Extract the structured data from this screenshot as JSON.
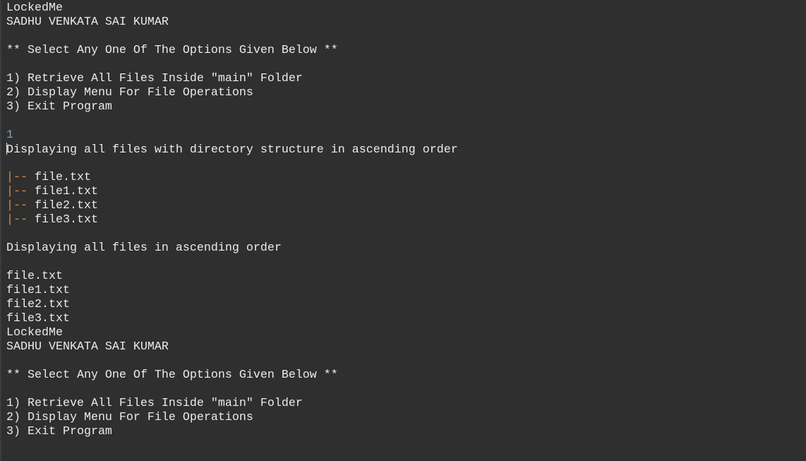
{
  "console": {
    "menu1": {
      "app": "LockedMe",
      "author": "SADHU VENKATA SAI KUMAR",
      "prompt": "** Select Any One Of The Options Given Below **",
      "options": [
        "1) Retrieve All Files Inside \"main\" Folder",
        "2) Display Menu For File Operations",
        "3) Exit Program"
      ]
    },
    "user_input": "1",
    "tree_heading": "Displaying all files with directory structure in ascending order",
    "tree_prefix": "|--",
    "tree_files": [
      "file.txt",
      "file1.txt",
      "file2.txt",
      "file3.txt"
    ],
    "list_heading": "Displaying all files in ascending order",
    "list_files": [
      "file.txt",
      "file1.txt",
      "file2.txt",
      "file3.txt"
    ],
    "menu2": {
      "app": "LockedMe",
      "author": "SADHU VENKATA SAI KUMAR",
      "prompt": "** Select Any One Of The Options Given Below **",
      "options": [
        "1) Retrieve All Files Inside \"main\" Folder",
        "2) Display Menu For File Operations",
        "3) Exit Program"
      ]
    }
  }
}
